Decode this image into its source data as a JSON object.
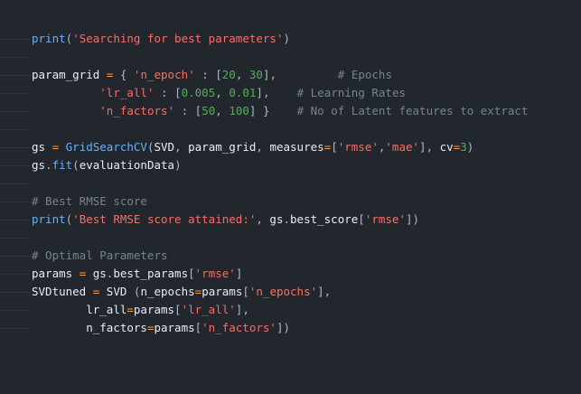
{
  "colors": {
    "background": "#22272e",
    "plain": "#e6edf3",
    "function": "#6ab0f3",
    "string": "#f47067",
    "number": "#57ab5a",
    "comment": "#768390",
    "operator": "#f69d50",
    "punctuation": "#adbac7"
  },
  "lines": [
    [
      [
        "fn",
        "print"
      ],
      [
        "punc",
        "("
      ],
      [
        "str",
        "'Searching for best parameters'"
      ],
      [
        "punc",
        ")"
      ]
    ],
    [],
    [
      [
        "plain",
        "param_grid "
      ],
      [
        "op",
        "="
      ],
      [
        "plain",
        " "
      ],
      [
        "punc",
        "{"
      ],
      [
        "plain",
        " "
      ],
      [
        "str",
        "'n_epoch'"
      ],
      [
        "plain",
        " "
      ],
      [
        "punc",
        ":"
      ],
      [
        "plain",
        " "
      ],
      [
        "punc",
        "["
      ],
      [
        "num",
        "20"
      ],
      [
        "punc",
        ","
      ],
      [
        "plain",
        " "
      ],
      [
        "num",
        "30"
      ],
      [
        "punc",
        "],"
      ],
      [
        "plain",
        "         "
      ],
      [
        "com",
        "# Epochs"
      ]
    ],
    [
      [
        "plain",
        "          "
      ],
      [
        "str",
        "'lr_all'"
      ],
      [
        "plain",
        " "
      ],
      [
        "punc",
        ":"
      ],
      [
        "plain",
        " "
      ],
      [
        "punc",
        "["
      ],
      [
        "num",
        "0.005"
      ],
      [
        "punc",
        ","
      ],
      [
        "plain",
        " "
      ],
      [
        "num",
        "0.01"
      ],
      [
        "punc",
        "],"
      ],
      [
        "plain",
        "    "
      ],
      [
        "com",
        "# Learning Rates"
      ]
    ],
    [
      [
        "plain",
        "          "
      ],
      [
        "str",
        "'n_factors'"
      ],
      [
        "plain",
        " "
      ],
      [
        "punc",
        ":"
      ],
      [
        "plain",
        " "
      ],
      [
        "punc",
        "["
      ],
      [
        "num",
        "50"
      ],
      [
        "punc",
        ","
      ],
      [
        "plain",
        " "
      ],
      [
        "num",
        "100"
      ],
      [
        "punc",
        "]"
      ],
      [
        "plain",
        " "
      ],
      [
        "punc",
        "}"
      ],
      [
        "plain",
        "    "
      ],
      [
        "com",
        "# No of Latent features to extract"
      ]
    ],
    [],
    [
      [
        "plain",
        "gs "
      ],
      [
        "op",
        "="
      ],
      [
        "plain",
        " "
      ],
      [
        "fn",
        "GridSearchCV"
      ],
      [
        "punc",
        "("
      ],
      [
        "plain",
        "SVD"
      ],
      [
        "punc",
        ","
      ],
      [
        "plain",
        " param_grid"
      ],
      [
        "punc",
        ","
      ],
      [
        "plain",
        " measures"
      ],
      [
        "op",
        "="
      ],
      [
        "punc",
        "["
      ],
      [
        "str",
        "'rmse'"
      ],
      [
        "punc",
        ","
      ],
      [
        "str",
        "'mae'"
      ],
      [
        "punc",
        "],"
      ],
      [
        "plain",
        " cv"
      ],
      [
        "op",
        "="
      ],
      [
        "num",
        "3"
      ],
      [
        "punc",
        ")"
      ]
    ],
    [
      [
        "plain",
        "gs"
      ],
      [
        "punc",
        "."
      ],
      [
        "fn",
        "fit"
      ],
      [
        "punc",
        "("
      ],
      [
        "plain",
        "evaluationData"
      ],
      [
        "punc",
        ")"
      ]
    ],
    [],
    [
      [
        "com",
        "# Best RMSE score"
      ]
    ],
    [
      [
        "fn",
        "print"
      ],
      [
        "punc",
        "("
      ],
      [
        "str",
        "'Best RMSE score attained:'"
      ],
      [
        "punc",
        ","
      ],
      [
        "plain",
        " gs"
      ],
      [
        "punc",
        "."
      ],
      [
        "plain",
        "best_score"
      ],
      [
        "punc",
        "["
      ],
      [
        "str",
        "'rmse'"
      ],
      [
        "punc",
        "])"
      ]
    ],
    [],
    [
      [
        "com",
        "# Optimal Parameters"
      ]
    ],
    [
      [
        "plain",
        "params "
      ],
      [
        "op",
        "="
      ],
      [
        "plain",
        " gs"
      ],
      [
        "punc",
        "."
      ],
      [
        "plain",
        "best_params"
      ],
      [
        "punc",
        "["
      ],
      [
        "str",
        "'rmse'"
      ],
      [
        "punc",
        "]"
      ]
    ],
    [
      [
        "plain",
        "SVDtuned "
      ],
      [
        "op",
        "="
      ],
      [
        "plain",
        " SVD "
      ],
      [
        "punc",
        "("
      ],
      [
        "plain",
        "n_epochs"
      ],
      [
        "op",
        "="
      ],
      [
        "plain",
        "params"
      ],
      [
        "punc",
        "["
      ],
      [
        "str",
        "'n_epochs'"
      ],
      [
        "punc",
        "],"
      ]
    ],
    [
      [
        "plain",
        "        lr_all"
      ],
      [
        "op",
        "="
      ],
      [
        "plain",
        "params"
      ],
      [
        "punc",
        "["
      ],
      [
        "str",
        "'lr_all'"
      ],
      [
        "punc",
        "],"
      ]
    ],
    [
      [
        "plain",
        "        n_factors"
      ],
      [
        "op",
        "="
      ],
      [
        "plain",
        "params"
      ],
      [
        "punc",
        "["
      ],
      [
        "str",
        "'n_factors'"
      ],
      [
        "punc",
        "])"
      ]
    ]
  ]
}
